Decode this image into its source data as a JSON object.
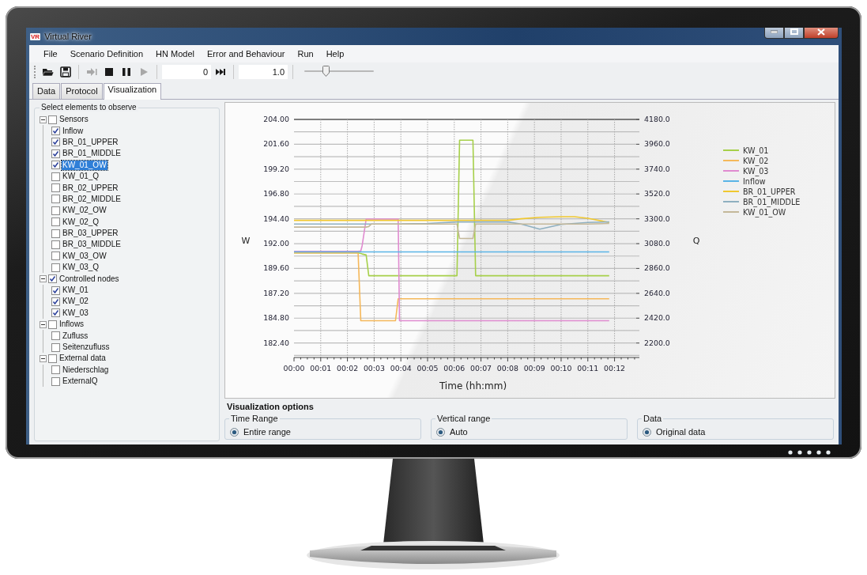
{
  "window": {
    "title": "Virtual River",
    "logo": "VR"
  },
  "menu": [
    {
      "label": "File"
    },
    {
      "label": "Scenario Definition"
    },
    {
      "label": "HN Model"
    },
    {
      "label": "Error and Behaviour"
    },
    {
      "label": "Run"
    },
    {
      "label": "Help"
    }
  ],
  "toolbar": {
    "groups": [
      [
        {
          "kind": "open",
          "disabled": false
        },
        {
          "kind": "save",
          "disabled": false
        }
      ],
      [
        {
          "kind": "step",
          "disabled": true
        },
        {
          "kind": "stop",
          "disabled": false
        },
        {
          "kind": "pause",
          "disabled": false
        },
        {
          "kind": "play",
          "disabled": true
        }
      ],
      [
        {
          "kind": "field",
          "value": "0"
        },
        {
          "kind": "skip",
          "disabled": false
        }
      ],
      [
        {
          "kind": "field",
          "value": "1.0"
        }
      ],
      [
        {
          "kind": "slider",
          "level": 0.31
        }
      ]
    ]
  },
  "tabs": [
    {
      "label": "Data",
      "selected": false
    },
    {
      "label": "Protocol",
      "selected": false
    },
    {
      "label": "Visualization",
      "selected": true
    }
  ],
  "tree": {
    "title": "Select elements to observe",
    "items": [
      {
        "label": "Sensors",
        "checked": false,
        "selected": false,
        "expanded": true,
        "children": [
          {
            "label": "Inflow",
            "checked": true,
            "selected": false
          },
          {
            "label": "BR_01_UPPER",
            "checked": true,
            "selected": false
          },
          {
            "label": "BR_01_MIDDLE",
            "checked": true,
            "selected": false
          },
          {
            "label": "KW_01_OW",
            "checked": true,
            "selected": true
          },
          {
            "label": "KW_01_Q",
            "checked": false,
            "selected": false
          },
          {
            "label": "BR_02_UPPER",
            "checked": false,
            "selected": false
          },
          {
            "label": "BR_02_MIDDLE",
            "checked": false,
            "selected": false
          },
          {
            "label": "KW_02_OW",
            "checked": false,
            "selected": false
          },
          {
            "label": "KW_02_Q",
            "checked": false,
            "selected": false
          },
          {
            "label": "BR_03_UPPER",
            "checked": false,
            "selected": false
          },
          {
            "label": "BR_03_MIDDLE",
            "checked": false,
            "selected": false
          },
          {
            "label": "KW_03_OW",
            "checked": false,
            "selected": false
          },
          {
            "label": "KW_03_Q",
            "checked": false,
            "selected": false
          }
        ]
      },
      {
        "label": "Controlled nodes",
        "checked": true,
        "selected": false,
        "expanded": true,
        "children": [
          {
            "label": "KW_01",
            "checked": true,
            "selected": false
          },
          {
            "label": "KW_02",
            "checked": true,
            "selected": false
          },
          {
            "label": "KW_03",
            "checked": true,
            "selected": false
          }
        ]
      },
      {
        "label": "Inflows",
        "checked": false,
        "selected": false,
        "expanded": true,
        "children": [
          {
            "label": "Zufluss",
            "checked": false,
            "selected": false
          },
          {
            "label": "Seitenzufluss",
            "checked": false,
            "selected": false
          }
        ]
      },
      {
        "label": "External data",
        "checked": false,
        "selected": false,
        "expanded": true,
        "children": [
          {
            "label": "Niederschlag",
            "checked": false,
            "selected": false
          },
          {
            "label": "ExternalQ",
            "checked": false,
            "selected": false
          }
        ]
      }
    ]
  },
  "chart_panel": {
    "chart_data": {
      "type": "line",
      "grid": true,
      "legend": true,
      "xlabel": "Time (hh:mm)",
      "ylabel": "W",
      "xlim": [
        0,
        12.93
      ],
      "ylim": [
        181.0,
        204.0
      ],
      "xticks": [
        {
          "value": 0,
          "label": "00:00"
        },
        {
          "value": 1,
          "label": "00:01"
        },
        {
          "value": 2,
          "label": "00:02"
        },
        {
          "value": 3,
          "label": "00:03"
        },
        {
          "value": 4,
          "label": "00:04"
        },
        {
          "value": 5,
          "label": "00:05"
        },
        {
          "value": 6,
          "label": "00:06"
        },
        {
          "value": 7,
          "label": "00:07"
        },
        {
          "value": 8,
          "label": "00:08"
        },
        {
          "value": 9,
          "label": "00:09"
        },
        {
          "value": 10,
          "label": "00:10"
        },
        {
          "value": 11,
          "label": "00:11"
        },
        {
          "value": 12,
          "label": "00:12"
        }
      ],
      "yticks": [
        {
          "value": 204.0,
          "label": "204.00"
        },
        {
          "value": 201.6,
          "label": "201.60"
        },
        {
          "value": 199.2,
          "label": "199.20"
        },
        {
          "value": 196.8,
          "label": "196.80"
        },
        {
          "value": 194.4,
          "label": "194.40"
        },
        {
          "value": 192.0,
          "label": "192.00"
        },
        {
          "value": 189.6,
          "label": "189.60"
        },
        {
          "value": 187.2,
          "label": "187.20"
        },
        {
          "value": 184.8,
          "label": "184.80"
        },
        {
          "value": 182.4,
          "label": "182.40"
        }
      ],
      "x": [
        0,
        2.4,
        2.5,
        2.55,
        2.7,
        2.8,
        2.9,
        3.8,
        3.9,
        3.95,
        5,
        6.1,
        6.2,
        6.7,
        6.8,
        8,
        8.5,
        9.2,
        10,
        10.5,
        11,
        11.8
      ],
      "series": [
        {
          "name": "KW_01",
          "color": "#a6d04a",
          "values": [
            191.1,
            191.1,
            191.05,
            191.0,
            190.9,
            188.9,
            188.9,
            188.9,
            188.9,
            188.9,
            188.9,
            188.9,
            202.0,
            202.0,
            188.9,
            188.9,
            188.9,
            188.9,
            188.9,
            188.9,
            188.9,
            188.9
          ]
        },
        {
          "name": "KW_02",
          "color": "#f5b85a",
          "values": [
            191.1,
            191.1,
            184.55,
            184.55,
            184.55,
            184.55,
            184.55,
            184.55,
            186.67,
            186.67,
            186.67,
            186.67,
            186.67,
            186.67,
            186.67,
            186.67,
            186.67,
            186.67,
            186.67,
            186.67,
            186.67,
            186.67
          ]
        },
        {
          "name": "KW_03",
          "color": "#e08bd0",
          "values": [
            191.25,
            191.25,
            191.3,
            191.8,
            194.37,
            194.37,
            194.37,
            194.37,
            194.37,
            184.55,
            184.55,
            184.55,
            184.55,
            184.55,
            184.55,
            184.55,
            184.55,
            184.55,
            184.55,
            184.55,
            184.55,
            184.55
          ]
        },
        {
          "name": "Inflow",
          "color": "#5ab4e6",
          "values": [
            191.2,
            191.2,
            191.2,
            191.2,
            191.2,
            191.2,
            191.2,
            191.2,
            191.2,
            191.2,
            191.2,
            191.2,
            191.2,
            191.2,
            191.2,
            191.2,
            191.2,
            191.2,
            191.2,
            191.2,
            191.2,
            191.2
          ]
        },
        {
          "name": "BR_01_UPPER",
          "color": "#f0c830",
          "values": [
            194.25,
            194.25,
            194.25,
            194.25,
            194.25,
            194.25,
            194.25,
            194.25,
            194.25,
            194.25,
            194.25,
            194.25,
            194.25,
            194.25,
            194.25,
            194.25,
            194.4,
            194.55,
            194.6,
            194.6,
            194.45,
            194.05
          ]
        },
        {
          "name": "BR_01_MIDDLE",
          "color": "#8fb0c0",
          "values": [
            193.9,
            193.9,
            193.9,
            193.9,
            193.9,
            193.9,
            193.9,
            193.9,
            193.9,
            193.9,
            193.95,
            194.1,
            194.1,
            194.1,
            194.1,
            194.1,
            193.9,
            193.4,
            193.85,
            193.95,
            194.05,
            194.1
          ]
        },
        {
          "name": "KW_01_OW",
          "color": "#c4b89a",
          "values": [
            193.6,
            193.6,
            193.6,
            193.6,
            193.6,
            193.65,
            193.9,
            193.9,
            193.9,
            193.9,
            193.9,
            193.9,
            192.5,
            192.5,
            193.9,
            193.9,
            193.9,
            193.9,
            193.9,
            193.9,
            193.9,
            193.95
          ]
        }
      ]
    },
    "right_axis": {
      "label": "Q",
      "ticks": [
        "4180.0",
        "3960.0",
        "3740.0",
        "3520.0",
        "3300.0",
        "3080.0",
        "2860.0",
        "2640.0",
        "2420.0",
        "2200.0"
      ]
    }
  },
  "visualization_options": {
    "title": "Visualization options",
    "groups": [
      {
        "title": "Time Range",
        "option": {
          "label": "Entire range",
          "selected": true
        }
      },
      {
        "title": "Vertical range",
        "option": {
          "label": "Auto",
          "selected": true
        }
      },
      {
        "title": "Data",
        "option": {
          "label": "Original data",
          "selected": true
        }
      }
    ]
  }
}
